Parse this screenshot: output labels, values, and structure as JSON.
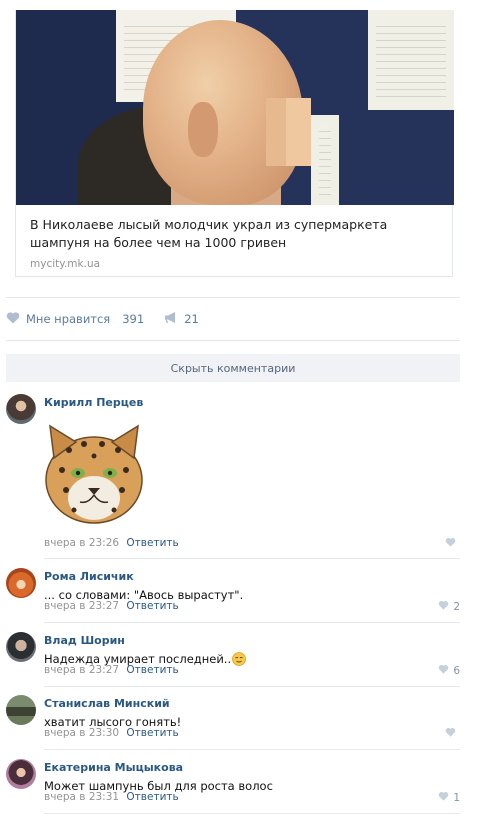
{
  "post": {
    "title": "В Николаеве лысый молодчик украл из супермаркета шампуня на более чем на 1000 гривен",
    "domain": "mycity.mk.ua"
  },
  "actions": {
    "like_label": "Мне нравится",
    "like_count": "391",
    "share_count": "21"
  },
  "hide_comments_label": "Скрыть комментарии",
  "comments": [
    {
      "author": "Кирилл Перцев",
      "text": "",
      "time": "вчера в 23:26",
      "reply": "Ответить",
      "likes": ""
    },
    {
      "author": "Рома Лисичик",
      "text": "... со словами: \"Авось вырастут\".",
      "time": "вчера в 23:27",
      "reply": "Ответить",
      "likes": "2"
    },
    {
      "author": "Влад Шорин",
      "text": "Надежда умирает последней..",
      "time": "вчера в 23:27",
      "reply": "Ответить",
      "likes": "6"
    },
    {
      "author": "Станислав Минский",
      "text": "хватит лысого гонять!",
      "time": "вчера в 23:30",
      "reply": "Ответить",
      "likes": ""
    },
    {
      "author": "Екатерина Мыцыкова",
      "text": "Может шампунь был для роста волос",
      "time": "вчера в 23:31",
      "reply": "Ответить",
      "likes": "1"
    }
  ],
  "icons": {
    "like": "heart-icon",
    "share": "megaphone-icon",
    "emoji": "relieved-face-emoji-icon",
    "sticker": "leopard-sticker-icon"
  },
  "colors": {
    "link": "#2a5885",
    "meta": "#939393",
    "action": "#5a7ba1",
    "button_bg": "#f0f2f5"
  }
}
